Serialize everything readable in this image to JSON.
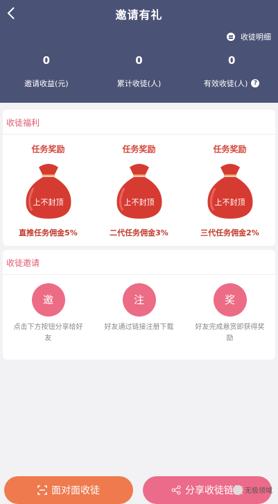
{
  "header": {
    "title": "邀请有礼",
    "records_link": "收徒明细",
    "stats": [
      {
        "value": "0",
        "label": "邀请收益(元)"
      },
      {
        "value": "0",
        "label": "累计收徒(人)"
      },
      {
        "value": "0",
        "label": "有效收徒(人)"
      }
    ]
  },
  "welfare": {
    "title": "收徒福利",
    "items": [
      {
        "title": "任务奖励",
        "bag_text": "上不封顶",
        "commission": "直推任务佣金5%"
      },
      {
        "title": "任务奖励",
        "bag_text": "上不封顶",
        "commission": "二代任务佣金3%"
      },
      {
        "title": "任务奖励",
        "bag_text": "上不封顶",
        "commission": "三代任务佣金2%"
      }
    ]
  },
  "invite": {
    "title": "收徒邀请",
    "steps": [
      {
        "icon_char": "邀",
        "text": "点击下方按钮分享给好友"
      },
      {
        "icon_char": "注",
        "text": "好友通过链接注册下载"
      },
      {
        "icon_char": "奖",
        "text": "好友完成悬赏即获得奖励"
      }
    ]
  },
  "buttons": {
    "face_to_face": "面对面收徒",
    "share": "分享收徒链接"
  },
  "watermark": "无极领域",
  "colors": {
    "header_bg": "#4a5275",
    "accent_pink": "#ec6b85",
    "accent_orange": "#ee7a4d",
    "bag_red": "#d63b32"
  }
}
